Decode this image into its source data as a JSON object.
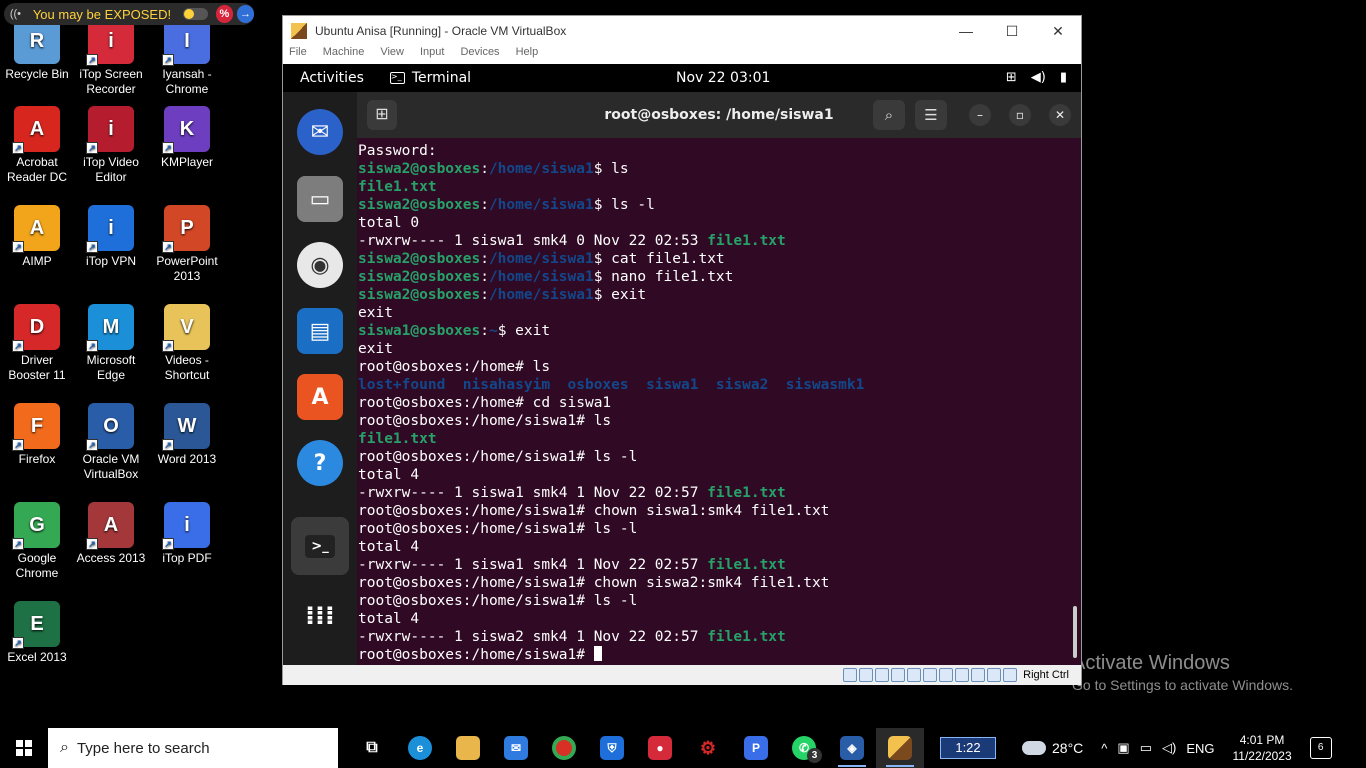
{
  "exposed_banner": {
    "text": "You may be EXPOSED!",
    "percent_icon": "%",
    "arrow_icon": "→"
  },
  "desktop_icons": [
    {
      "label": "Recycle Bin",
      "icon": "recycle-bin-icon",
      "color": "#5a9bd5"
    },
    {
      "label": "iTop Screen Recorder",
      "icon": "screen-recorder-icon",
      "color": "#d42a3a"
    },
    {
      "label": "Iyansah - Chrome",
      "icon": "chrome-profile-icon",
      "color": "#4a6ee0"
    },
    {
      "label": "Acrobat Reader DC",
      "icon": "acrobat-icon",
      "color": "#d7261e"
    },
    {
      "label": "iTop Video Editor",
      "icon": "video-editor-icon",
      "color": "#b51d2e"
    },
    {
      "label": "KMPlayer",
      "icon": "kmplayer-icon",
      "color": "#6d3fc0"
    },
    {
      "label": "AIMP",
      "icon": "aimp-icon",
      "color": "#f2a51a"
    },
    {
      "label": "iTop VPN",
      "icon": "vpn-icon",
      "color": "#1e6fd9"
    },
    {
      "label": "PowerPoint 2013",
      "icon": "powerpoint-icon",
      "color": "#d24726"
    },
    {
      "label": "Driver Booster 11",
      "icon": "driver-booster-icon",
      "color": "#d62828"
    },
    {
      "label": "Microsoft Edge",
      "icon": "edge-icon",
      "color": "#1b8fd8"
    },
    {
      "label": "Videos - Shortcut",
      "icon": "videos-folder-icon",
      "color": "#e8c35a"
    },
    {
      "label": "Firefox",
      "icon": "firefox-icon",
      "color": "#f26b1d"
    },
    {
      "label": "Oracle VM VirtualBox",
      "icon": "virtualbox-icon",
      "color": "#2a5da8"
    },
    {
      "label": "Word 2013",
      "icon": "word-icon",
      "color": "#2b5797"
    },
    {
      "label": "Google Chrome",
      "icon": "chrome-icon",
      "color": "#34a853"
    },
    {
      "label": "Access 2013",
      "icon": "access-icon",
      "color": "#a4373a"
    },
    {
      "label": "iTop PDF",
      "icon": "itop-pdf-icon",
      "color": "#3a6ee8"
    },
    {
      "label": "Excel 2013",
      "icon": "excel-icon",
      "color": "#1e7145"
    }
  ],
  "activate": {
    "title": "Activate Windows",
    "subtitle": "Go to Settings to activate Windows."
  },
  "vbox": {
    "title": "Ubuntu Anisa [Running] - Oracle VM VirtualBox",
    "menu": [
      "File",
      "Machine",
      "View",
      "Input",
      "Devices",
      "Help"
    ],
    "status_host_key": "Right Ctrl"
  },
  "gnome": {
    "activities": "Activities",
    "app": "Terminal",
    "clock": "Nov 22  03:01"
  },
  "terminal": {
    "title": "root@osboxes: /home/siswa1",
    "lines": [
      [
        [
          "",
          "Password:"
        ]
      ],
      [
        [
          "ug",
          "siswa2@osboxes"
        ],
        [
          "",
          ":"
        ],
        [
          "pth",
          "/home/siswa1"
        ],
        [
          "",
          "$ ls"
        ]
      ],
      [
        [
          "fl",
          "file1.txt"
        ]
      ],
      [
        [
          "ug",
          "siswa2@osboxes"
        ],
        [
          "",
          ":"
        ],
        [
          "pth",
          "/home/siswa1"
        ],
        [
          "",
          "$ ls -l"
        ]
      ],
      [
        [
          "",
          "total 0"
        ]
      ],
      [
        [
          "",
          "-rwxrw---- 1 siswa1 smk4 0 Nov 22 02:53 "
        ],
        [
          "fl",
          "file1.txt"
        ]
      ],
      [
        [
          "ug",
          "siswa2@osboxes"
        ],
        [
          "",
          ":"
        ],
        [
          "pth",
          "/home/siswa1"
        ],
        [
          "",
          "$ cat file1.txt"
        ]
      ],
      [
        [
          "ug",
          "siswa2@osboxes"
        ],
        [
          "",
          ":"
        ],
        [
          "pth",
          "/home/siswa1"
        ],
        [
          "",
          "$ nano file1.txt"
        ]
      ],
      [
        [
          "ug",
          "siswa2@osboxes"
        ],
        [
          "",
          ":"
        ],
        [
          "pth",
          "/home/siswa1"
        ],
        [
          "",
          "$ exit"
        ]
      ],
      [
        [
          "",
          "exit"
        ]
      ],
      [
        [
          "ug",
          "siswa1@osboxes"
        ],
        [
          "",
          ":"
        ],
        [
          "pth",
          "~"
        ],
        [
          "",
          "$ exit"
        ]
      ],
      [
        [
          "",
          "exit"
        ]
      ],
      [
        [
          "",
          "root@osboxes:/home# ls"
        ]
      ],
      [
        [
          "dir",
          "lost+found  nisahasyim  osboxes  siswa1  siswa2  siswasmk1"
        ]
      ],
      [
        [
          "",
          "root@osboxes:/home# cd siswa1"
        ]
      ],
      [
        [
          "",
          "root@osboxes:/home/siswa1# ls"
        ]
      ],
      [
        [
          "fl",
          "file1.txt"
        ]
      ],
      [
        [
          "",
          "root@osboxes:/home/siswa1# ls -l"
        ]
      ],
      [
        [
          "",
          "total 4"
        ]
      ],
      [
        [
          "",
          "-rwxrw---- 1 siswa1 smk4 1 Nov 22 02:57 "
        ],
        [
          "fl",
          "file1.txt"
        ]
      ],
      [
        [
          "",
          "root@osboxes:/home/siswa1# chown siswa1:smk4 file1.txt"
        ]
      ],
      [
        [
          "",
          "root@osboxes:/home/siswa1# ls -l"
        ]
      ],
      [
        [
          "",
          "total 4"
        ]
      ],
      [
        [
          "",
          "-rwxrw---- 1 siswa1 smk4 1 Nov 22 02:57 "
        ],
        [
          "fl",
          "file1.txt"
        ]
      ],
      [
        [
          "",
          "root@osboxes:/home/siswa1# chown siswa2:smk4 file1.txt"
        ]
      ],
      [
        [
          "",
          "root@osboxes:/home/siswa1# ls -l"
        ]
      ],
      [
        [
          "",
          "total 4"
        ]
      ],
      [
        [
          "",
          "-rwxrw---- 1 siswa2 smk4 1 Nov 22 02:57 "
        ],
        [
          "fl",
          "file1.txt"
        ]
      ],
      [
        [
          "",
          "root@osboxes:/home/siswa1# "
        ],
        [
          "cursor",
          ""
        ]
      ]
    ]
  },
  "taskbar": {
    "search_placeholder": "Type here to search",
    "whatsapp_badge": "3",
    "widget_value": "1:22",
    "weather": "28°C",
    "language": "ENG",
    "time": "4:01 PM",
    "date": "11/22/2023",
    "notification_count": "6"
  }
}
